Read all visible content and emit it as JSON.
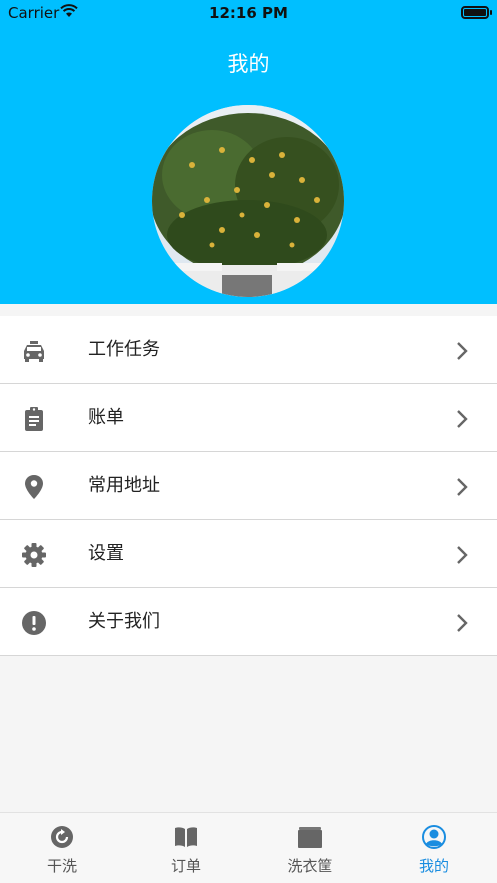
{
  "status_bar": {
    "carrier": "Carrier",
    "time": "12:16 PM"
  },
  "header": {
    "title": "我的",
    "background_color": "#00bfff"
  },
  "menu": {
    "items": [
      {
        "label": "工作任务",
        "icon": "taxi-icon"
      },
      {
        "label": "账单",
        "icon": "clipboard-icon"
      },
      {
        "label": "常用地址",
        "icon": "location-pin-icon"
      },
      {
        "label": "设置",
        "icon": "gear-icon"
      },
      {
        "label": "关于我们",
        "icon": "exclamation-circle-icon"
      }
    ]
  },
  "tab_bar": {
    "tabs": [
      {
        "label": "干洗",
        "icon": "refresh-circle-icon",
        "active": false
      },
      {
        "label": "订单",
        "icon": "open-book-icon",
        "active": false
      },
      {
        "label": "洗衣筐",
        "icon": "basket-box-icon",
        "active": false
      },
      {
        "label": "我的",
        "icon": "user-profile-icon",
        "active": true
      }
    ],
    "active_color": "#1a8de0",
    "inactive_color": "#555555"
  }
}
